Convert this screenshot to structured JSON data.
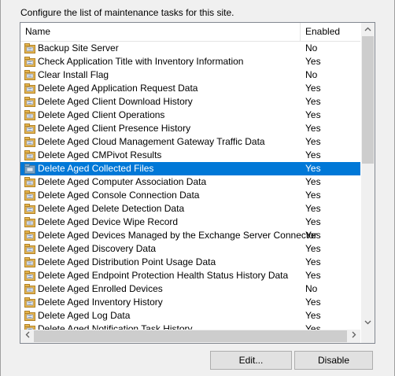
{
  "instruction": "Configure the list of maintenance tasks for this site.",
  "columns": {
    "name": "Name",
    "enabled": "Enabled"
  },
  "tasks": [
    {
      "name": "Backup Site Server",
      "enabled": "No"
    },
    {
      "name": "Check Application Title with Inventory Information",
      "enabled": "Yes"
    },
    {
      "name": "Clear Install Flag",
      "enabled": "No"
    },
    {
      "name": "Delete Aged Application Request Data",
      "enabled": "Yes"
    },
    {
      "name": "Delete Aged Client Download History",
      "enabled": "Yes"
    },
    {
      "name": "Delete Aged Client Operations",
      "enabled": "Yes"
    },
    {
      "name": "Delete Aged Client Presence History",
      "enabled": "Yes"
    },
    {
      "name": "Delete Aged Cloud Management Gateway Traffic Data",
      "enabled": "Yes"
    },
    {
      "name": "Delete Aged CMPivot Results",
      "enabled": "Yes"
    },
    {
      "name": "Delete Aged Collected Files",
      "enabled": "Yes",
      "selected": true
    },
    {
      "name": "Delete Aged Computer Association Data",
      "enabled": "Yes"
    },
    {
      "name": "Delete Aged Console Connection Data",
      "enabled": "Yes"
    },
    {
      "name": "Delete Aged Delete Detection Data",
      "enabled": "Yes"
    },
    {
      "name": "Delete Aged Device Wipe Record",
      "enabled": "Yes"
    },
    {
      "name": "Delete Aged Devices Managed by the Exchange Server Connector",
      "enabled": "Yes"
    },
    {
      "name": "Delete Aged Discovery Data",
      "enabled": "Yes"
    },
    {
      "name": "Delete Aged Distribution Point Usage Data",
      "enabled": "Yes"
    },
    {
      "name": "Delete Aged Endpoint Protection Health Status History Data",
      "enabled": "Yes"
    },
    {
      "name": "Delete Aged Enrolled Devices",
      "enabled": "No"
    },
    {
      "name": "Delete Aged Inventory History",
      "enabled": "Yes"
    },
    {
      "name": "Delete Aged Log Data",
      "enabled": "Yes"
    },
    {
      "name": "Delete Aged Notification Task History",
      "enabled": "Yes"
    }
  ],
  "icons": {
    "task": "task-icon",
    "scroll_up": "chevron-up-icon",
    "scroll_down": "chevron-down-icon",
    "scroll_left": "chevron-left-icon",
    "scroll_right": "chevron-right-icon"
  },
  "colors": {
    "selection": "#0078d7",
    "task_icon": "#e8b64c"
  },
  "buttons": {
    "edit": "Edit...",
    "disable": "Disable"
  }
}
